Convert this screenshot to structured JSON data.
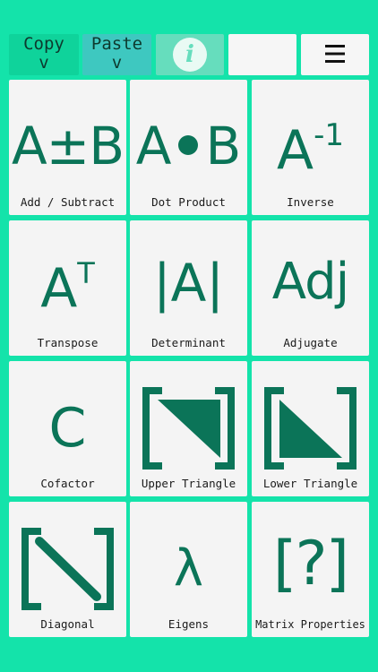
{
  "toolbar": {
    "copy_label": "Copy\nv",
    "paste_label": "Paste\nv",
    "info_glyph": "i"
  },
  "operations": [
    {
      "symbol": "A±B",
      "label": "Add / Subtract"
    },
    {
      "symbol_left": "A",
      "symbol_right": "B",
      "label": "Dot Product"
    },
    {
      "symbol": "A",
      "superscript": "-1",
      "label": "Inverse"
    },
    {
      "symbol": "A",
      "superscript": "T",
      "label": "Transpose"
    },
    {
      "symbol": "|A|",
      "label": "Determinant"
    },
    {
      "symbol": "Adj",
      "label": "Adjugate"
    },
    {
      "symbol": "C",
      "label": "Cofactor"
    },
    {
      "label": "Upper Triangle"
    },
    {
      "label": "Lower Triangle"
    },
    {
      "label": "Diagonal"
    },
    {
      "symbol": "λ",
      "label": "Eigens"
    },
    {
      "symbol": "[?]",
      "label": "Matrix Properties"
    }
  ],
  "colors": {
    "background": "#14e3aa",
    "tile": "#f4f4f4",
    "symbol": "#0b7458",
    "copy_button": "#0fd39b",
    "paste_button": "#3ec8c0",
    "info_button": "#66ddbd"
  }
}
